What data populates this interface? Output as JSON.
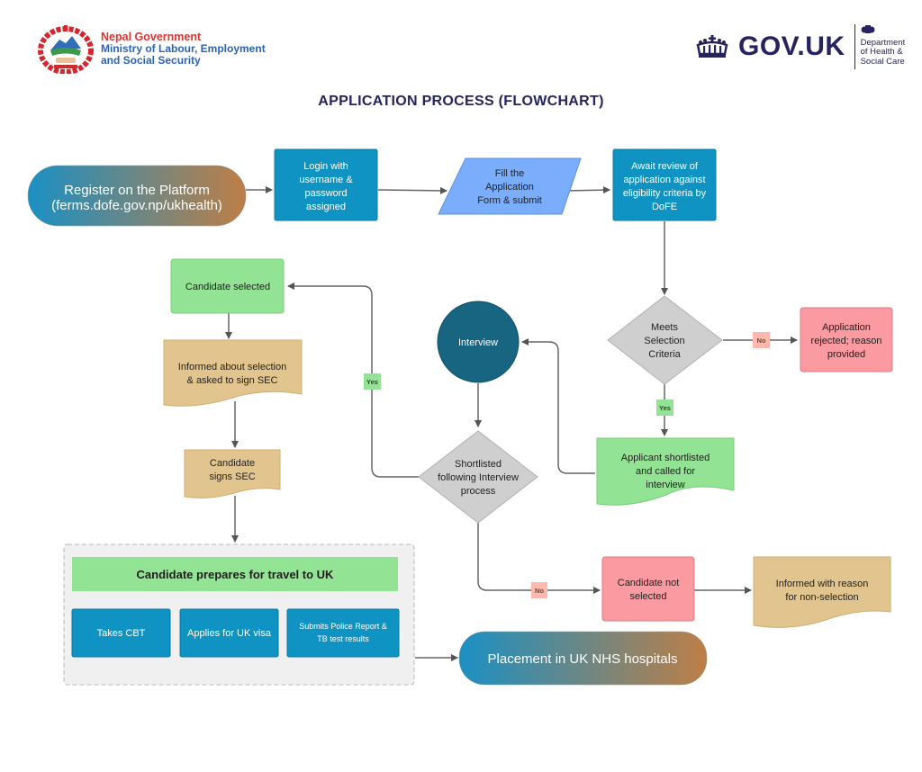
{
  "header": {
    "left_org": {
      "line1": "Nepal Government",
      "line2": "Ministry of Labour, Employment",
      "line3": "and Social Security",
      "emblem_icon": "nepal-emblem-icon"
    },
    "right_org": {
      "brand": "GOV.UK",
      "crown_icon": "crown-icon",
      "crest_icon": "royal-crest-icon",
      "dept_line1": "Department",
      "dept_line2": "of Health &",
      "dept_line3": "Social Care"
    }
  },
  "title": "APPLICATION PROCESS (FLOWCHART)",
  "colors": {
    "title": "#27235f",
    "process_blue": "#0f93c3",
    "input_blue": "#7aaefc",
    "decision_grey": "#cfcfcf",
    "green": "#92e393",
    "red": "#fb9aa1",
    "document_tan": "#e2c48f",
    "interview_teal": "#176581",
    "gradient_start": "#1a90c4",
    "gradient_end": "#be7e46"
  },
  "nodes": {
    "register": {
      "line1": "Register on the Platform",
      "line2": "(ferms.dofe.gov.np/ukhealth)"
    },
    "login": {
      "lines": [
        "Login with",
        "username &",
        "password",
        "assigned"
      ]
    },
    "fill_form": {
      "lines": [
        "Fill the",
        "Application",
        "Form  & submit"
      ]
    },
    "await_review": {
      "lines": [
        "Await review of",
        "application against",
        "eligibility criteria by",
        "DoFE"
      ]
    },
    "meets_criteria": {
      "lines": [
        "Meets",
        "Selection",
        "Criteria"
      ]
    },
    "rejected": {
      "lines": [
        "Application",
        "rejected; reason",
        "provided"
      ]
    },
    "shortlisted_called": {
      "lines": [
        "Applicant shortlisted",
        "and called for",
        "interview"
      ]
    },
    "interview": {
      "label": "Interview"
    },
    "shortlisted_decision": {
      "lines": [
        "Shortlisted",
        "following Interview",
        "process"
      ]
    },
    "candidate_selected": {
      "label": "Candidate selected"
    },
    "informed_selection": {
      "lines": [
        "Informed about selection",
        "& asked to sign SEC"
      ]
    },
    "signs_sec": {
      "lines": [
        "Candidate",
        "signs SEC"
      ]
    },
    "prepares": {
      "header": "Candidate prepares for travel to UK",
      "tasks": [
        {
          "lines": [
            "Takes CBT"
          ]
        },
        {
          "lines": [
            "Applies for UK visa"
          ]
        },
        {
          "lines": [
            "Submits Police Report &",
            "TB test results"
          ]
        }
      ]
    },
    "not_selected": {
      "lines": [
        "Candidate not",
        "selected"
      ]
    },
    "informed_reason": {
      "lines": [
        "Informed with reason",
        "for non-selection"
      ]
    },
    "placement": {
      "label": "Placement in UK NHS hospitals"
    }
  },
  "edge_labels": {
    "meets_no": "No",
    "meets_yes": "Yes",
    "shortlist_yes": "Yes",
    "shortlist_no": "No"
  }
}
